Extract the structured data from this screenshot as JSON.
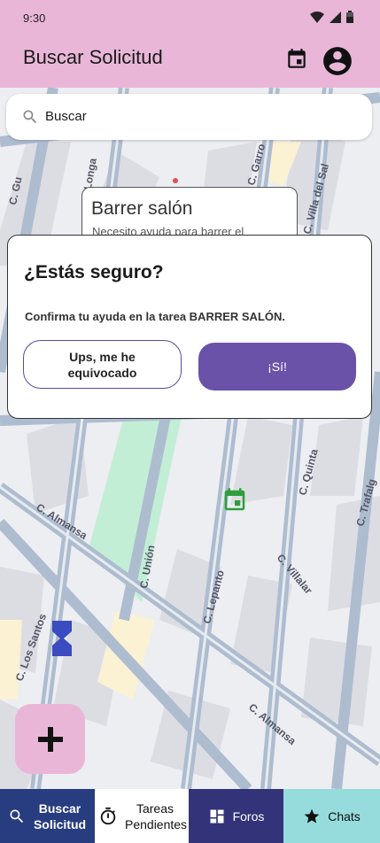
{
  "status_bar": {
    "time": "9:30"
  },
  "app_bar": {
    "title": "Buscar Solicitud"
  },
  "search": {
    "value": "Buscar"
  },
  "map": {
    "streets": [
      "C. Gu",
      "C. Longa",
      "C. Garro",
      "C. Villa del Sal",
      "C. Almansa",
      "C. Unión",
      "C. Quinta",
      "C. Trafalg",
      "C. Los Santos",
      "C. Lepanto",
      "C. Villalar",
      "C. Almansa"
    ]
  },
  "info_card": {
    "title": "Barrer salón",
    "description": "Necesito ayuda para barrer el"
  },
  "dialog": {
    "heading": "¿Estás seguro?",
    "message": "Confirma tu ayuda en la tarea BARRER SALÓN.",
    "cancel_label": "Ups, me he equivocado",
    "confirm_label": "¡Sí!"
  },
  "bottom_nav": [
    {
      "label": "Buscar Solicitud",
      "icon": "search-icon"
    },
    {
      "label": "Tareas Pendientes",
      "icon": "timer-icon"
    },
    {
      "label": "Foros",
      "icon": "dashboard-icon"
    },
    {
      "label": "Chats",
      "icon": "star-icon"
    }
  ],
  "colors": {
    "app_bar": "#e9b6d8",
    "primary_button": "#6a52a8",
    "nav_search": "#283c80",
    "nav_foros": "#33337a",
    "nav_chats": "#96dcdc",
    "calendar_marker": "#2e9e3a",
    "hourglass_marker": "#3b4cc0",
    "park": "#c2eed6"
  }
}
